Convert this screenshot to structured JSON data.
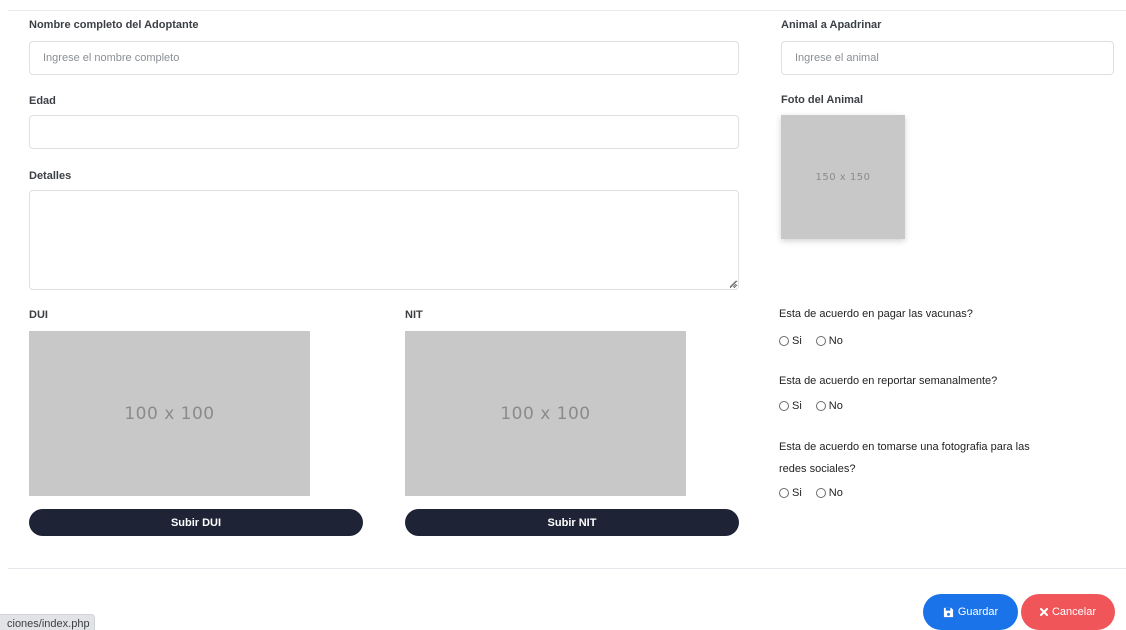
{
  "form": {
    "name_label": "Nombre completo del Adoptante",
    "name_placeholder": "Ingrese el nombre completo",
    "age_label": "Edad",
    "details_label": "Detalles",
    "animal_label": "Animal a Apadrinar",
    "animal_placeholder": "Ingrese el animal",
    "photo_label": "Foto del Animal",
    "photo_placeholder": "150 x 150",
    "dui_label": "DUI",
    "dui_placeholder": "100 x 100",
    "dui_button": "Subir DUI",
    "nit_label": "NIT",
    "nit_placeholder": "100 x 100",
    "nit_button": "Subir NIT"
  },
  "questions": [
    {
      "text": "Esta de acuerdo en pagar las vacunas?",
      "yes": "Si",
      "no": "No"
    },
    {
      "text": "Esta de acuerdo en reportar semanalmente?",
      "yes": "Si",
      "no": "No"
    },
    {
      "text": "Esta de acuerdo en tomarse una fotografia para las redes sociales?",
      "yes": "Si",
      "no": "No"
    }
  ],
  "actions": {
    "save_label": "Guardar",
    "cancel_label": "Cancelar"
  },
  "status_url": "ciones/index.php",
  "icons": {
    "save": "floppy-disk-icon",
    "cancel": "x-icon"
  },
  "colors": {
    "save": "#1a73e8",
    "cancel": "#f0555a",
    "upload": "#1e2436"
  }
}
